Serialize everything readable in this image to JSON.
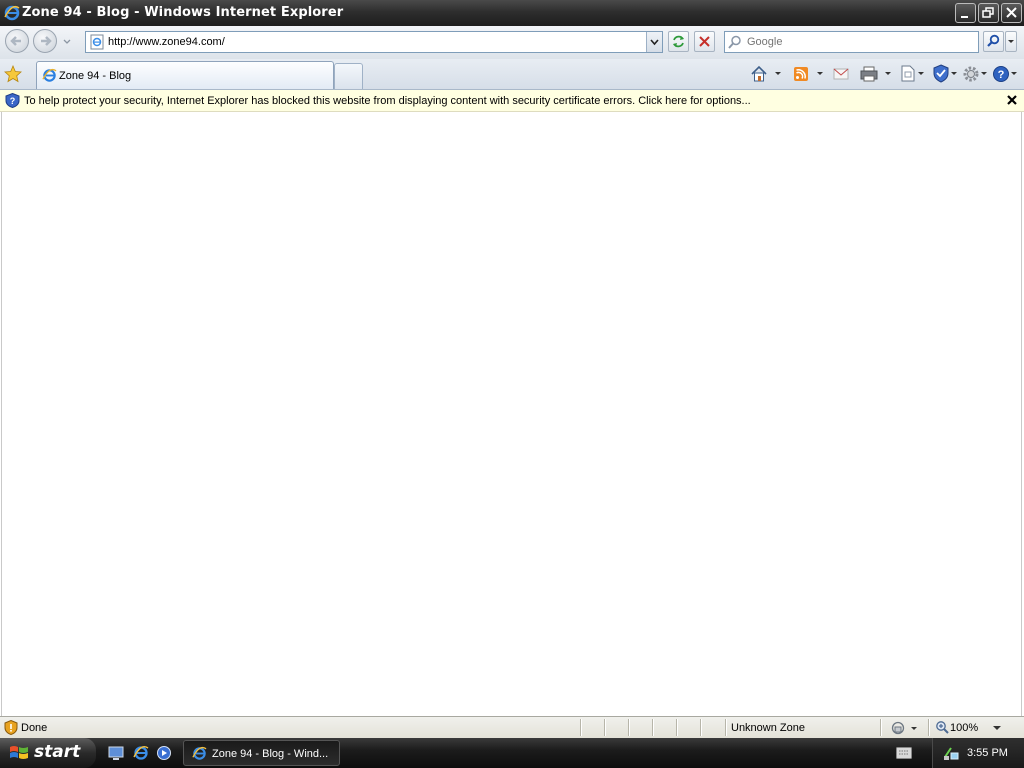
{
  "window": {
    "title": "Zone 94 - Blog - Windows Internet Explorer"
  },
  "navbar": {
    "address": "http://www.zone94.com/",
    "search_placeholder": "Google"
  },
  "tabs": [
    {
      "label": "Zone 94 - Blog",
      "active": true
    }
  ],
  "infobar": {
    "message": "To help protect your security, Internet Explorer has blocked this website from displaying content with security certificate errors. Click here for options..."
  },
  "statusbar": {
    "status": "Done",
    "zone": "Unknown Zone",
    "zoom": "100%"
  },
  "taskbar": {
    "start_label": "start",
    "task_label": "Zone 94 - Blog - Wind...",
    "clock": "3:55 PM"
  },
  "colors": {
    "infobar_bg": "#ffffe1",
    "title_bar": "#2e2e2e",
    "taskbar": "#1c1c1c"
  }
}
